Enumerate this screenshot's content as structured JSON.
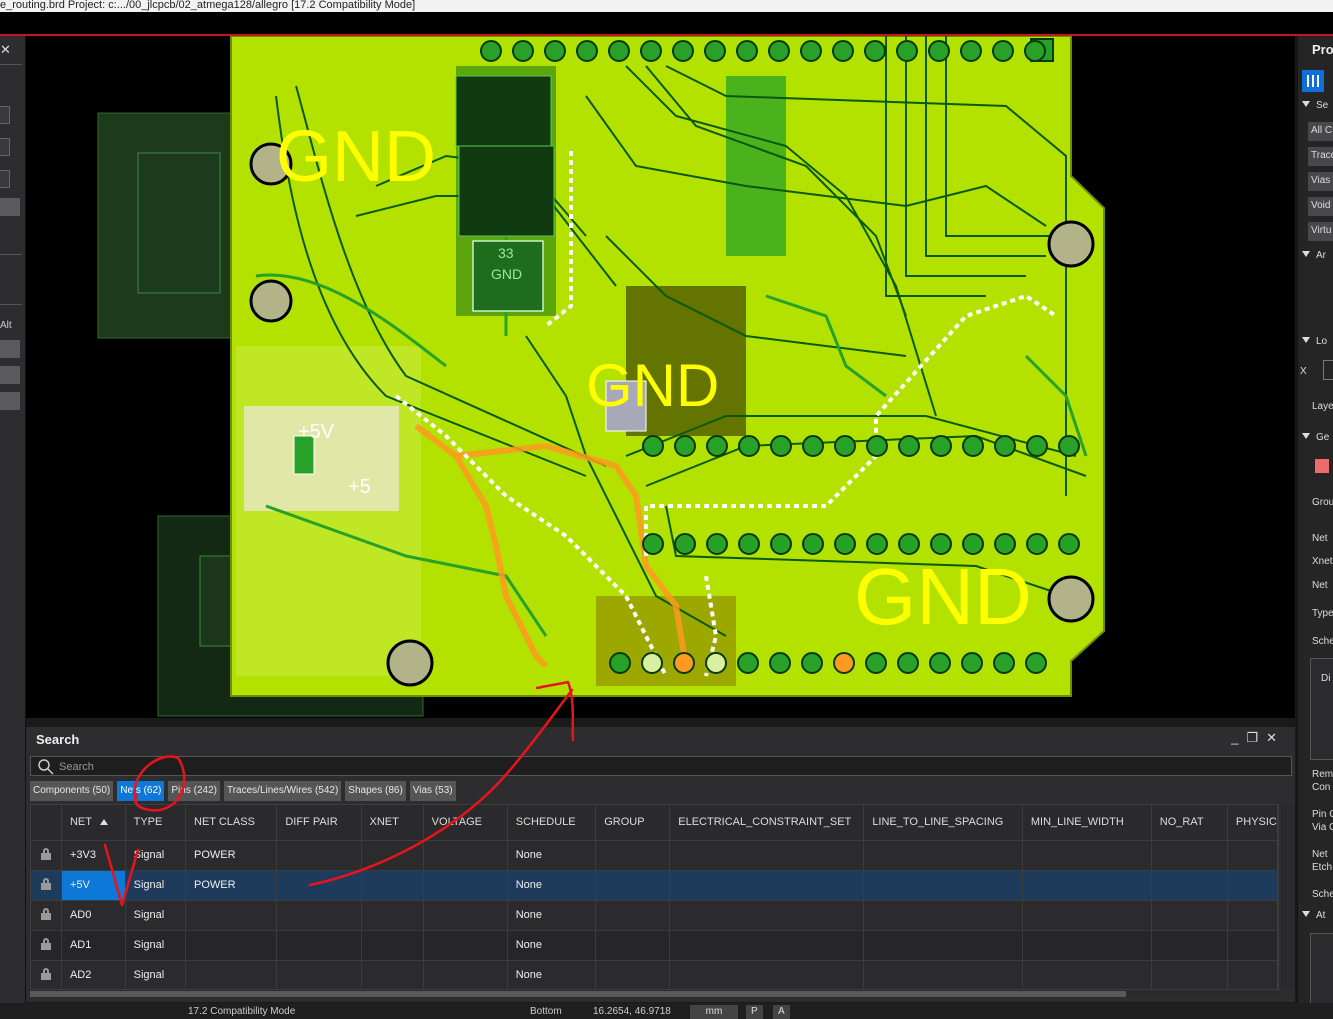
{
  "window": {
    "title": "e_routing.brd  Project: c:.../00_jlcpcb/02_atmega128/allegro [17.2 Compatibility Mode]"
  },
  "left_panel": {
    "close_glyph": "✕",
    "alt_label": "Alt"
  },
  "board": {
    "labels": {
      "gnd_top": "GND",
      "gnd_mid": "GND",
      "gnd_right": "GND",
      "ic_number": "33",
      "ic_gnd": "GND",
      "plus5v": "+5V",
      "plus5": "+5"
    },
    "colors": {
      "board": "#b8e600",
      "copper": "#27a127",
      "trace": "#0a5a0a",
      "highlight": "#ff9a20",
      "text": "#ffff00"
    }
  },
  "properties_panel": {
    "title": "Pro",
    "sections": [
      "Se",
      "Ar",
      "Lo",
      "Ge",
      "At"
    ],
    "filter_buttons": [
      "All C",
      "Trace",
      "Vias",
      "Void",
      "Virtu"
    ],
    "labels": {
      "x": "X",
      "layer": "Laye",
      "group": "Grou",
      "net": "Net",
      "xnet": "Xnet",
      "net2": "Net",
      "type": "Type",
      "schedule": "Sche",
      "di": "Di",
      "remove": "Rem",
      "conn": "Con",
      "pin": "Pin C",
      "via": "Via C",
      "net_etch": "Net",
      "etch": "Etch",
      "schedule2": "Sche"
    },
    "swatch_color": "#ef6b6b"
  },
  "search_panel": {
    "title": "Search",
    "controls": [
      "_",
      "❐",
      "✕"
    ],
    "search": {
      "placeholder": "Search"
    },
    "tabs": [
      {
        "label": "Components (50)",
        "active": false
      },
      {
        "label": "Nets (62)",
        "active": true
      },
      {
        "label": "Pins (242)",
        "active": false
      },
      {
        "label": "Traces/Lines/Wires (542)",
        "active": false
      },
      {
        "label": "Shapes (86)",
        "active": false
      },
      {
        "label": "Vias (53)",
        "active": false
      }
    ],
    "columns": [
      "NET",
      "TYPE",
      "NET CLASS",
      "DIFF PAIR",
      "XNET",
      "VOLTAGE",
      "SCHEDULE",
      "GROUP",
      "ELECTRICAL_CONSTRAINT_SET",
      "LINE_TO_LINE_SPACING",
      "MIN_LINE_WIDTH",
      "NO_RAT",
      "PHYSIC"
    ],
    "sort_column": "NET",
    "rows": [
      {
        "net": "+3V3",
        "type": "Signal",
        "net_class": "POWER",
        "diff_pair": "",
        "xnet": "",
        "voltage": "",
        "schedule": "None",
        "selected": false
      },
      {
        "net": "+5V",
        "type": "Signal",
        "net_class": "POWER",
        "diff_pair": "",
        "xnet": "",
        "voltage": "",
        "schedule": "None",
        "selected": true
      },
      {
        "net": "AD0",
        "type": "Signal",
        "net_class": "",
        "diff_pair": "",
        "xnet": "",
        "voltage": "",
        "schedule": "None",
        "selected": false
      },
      {
        "net": "AD1",
        "type": "Signal",
        "net_class": "",
        "diff_pair": "",
        "xnet": "",
        "voltage": "",
        "schedule": "None",
        "selected": false
      },
      {
        "net": "AD2",
        "type": "Signal",
        "net_class": "",
        "diff_pair": "",
        "xnet": "",
        "voltage": "",
        "schedule": "None",
        "selected": false
      }
    ]
  },
  "status_bar": {
    "mode": "17.2 Compatibility Mode",
    "layer": "Bottom",
    "coords": "16.2654, 46.9718",
    "units": "mm",
    "btn_p": "P",
    "btn_a": "A"
  },
  "annotation_color": "#e8141c"
}
